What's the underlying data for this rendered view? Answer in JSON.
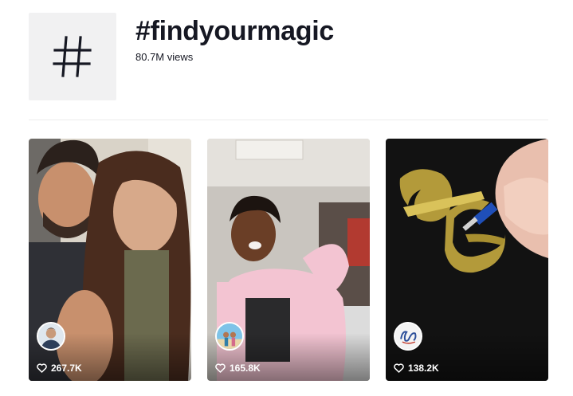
{
  "hashtag": {
    "title": "#findyourmagic",
    "views": "80.7M views"
  },
  "videos": [
    {
      "likes": "267.7K",
      "avatar_icon": "user-avatar-man-suit"
    },
    {
      "likes": "165.8K",
      "avatar_icon": "user-avatar-beach"
    },
    {
      "likes": "138.2K",
      "avatar_icon": "user-avatar-calligraphy-logo"
    }
  ],
  "colors": {
    "text": "#161823",
    "thumb_bg": "#f1f1f2",
    "divider": "#ededed"
  }
}
